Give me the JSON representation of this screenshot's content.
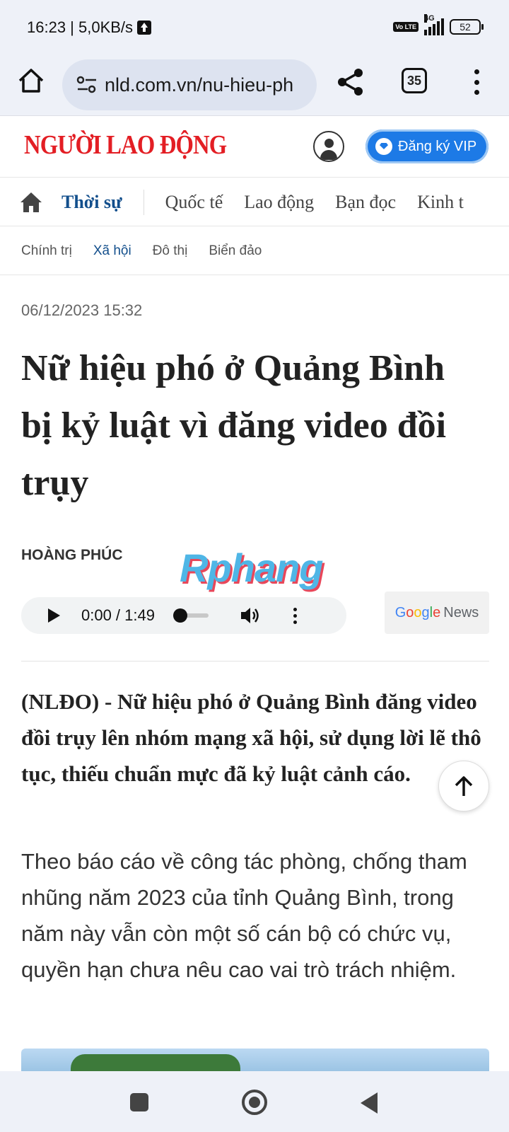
{
  "status_bar": {
    "time_speed": "16:23 | 5,0KB/s",
    "volte": "Vo LTE",
    "network": "4G",
    "battery": "52"
  },
  "browser": {
    "url": "nld.com.vn/nu-hieu-ph",
    "tab_count": "35"
  },
  "site": {
    "logo": "NGƯỜI LAO ĐỘNG",
    "vip_label": "Đăng ký VIP"
  },
  "main_nav": [
    {
      "label": "Thời sự",
      "active": true
    },
    {
      "label": "Quốc tế"
    },
    {
      "label": "Lao động"
    },
    {
      "label": "Bạn đọc"
    },
    {
      "label": "Kinh t"
    }
  ],
  "sub_nav": [
    {
      "label": "Chính trị"
    },
    {
      "label": "Xã hội",
      "active": true
    },
    {
      "label": "Đô thị"
    },
    {
      "label": "Biển đảo"
    }
  ],
  "article": {
    "date": "06/12/2023 15:32",
    "headline": "Nữ hiệu phó ở Quảng Bình bị kỷ luật vì đăng video đồi trụy",
    "author": "HOÀNG PHÚC",
    "watermark": "Rphang",
    "audio_time": "0:00 / 1:49",
    "google_news": {
      "google": "Google",
      "news": "News"
    },
    "sapo": "(NLĐO) - Nữ hiệu phó ở Quảng Bình đăng video đồi trụy lên nhóm mạng xã hội, sử dụng lời lẽ thô tục, thiếu chuẩn mực đã kỷ luật cảnh cáo.",
    "body": "Theo báo cáo về công tác phòng, chống tham nhũng năm 2023 của tỉnh Quảng Bình, trong năm này vẫn còn một số cán bộ có chức vụ, quyền hạn chưa nêu cao vai trò trách nhiệm."
  },
  "colors": {
    "logo_red": "#e31e24",
    "nav_active": "#134f8c",
    "vip_blue": "#1d7ae6"
  }
}
